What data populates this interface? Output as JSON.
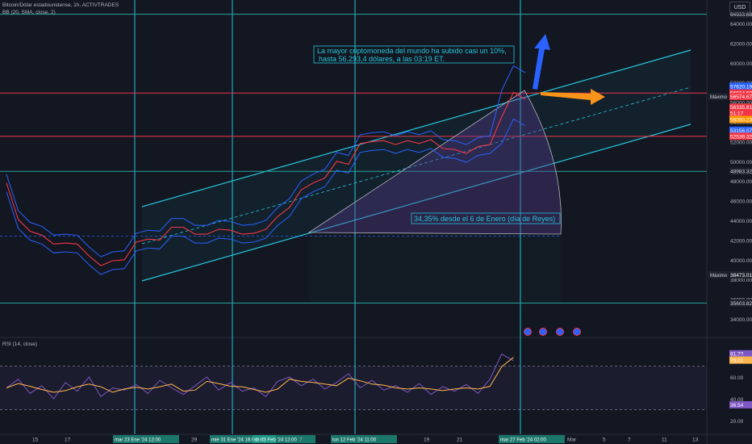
{
  "header": {
    "symbol_line": "Bitcoin/Dólar estadounidense, 1h, ACTIVTRADES",
    "indicator_line": "BB (20, SMA, close, 2)",
    "currency": "USD"
  },
  "rsi_header": "RSI (14, close)",
  "colors": {
    "background": "#131722",
    "cyan": "#26c6da",
    "red": "#f23645",
    "green": "#26a69a",
    "bb": "#2962ff",
    "rsi": "#7e57c2",
    "rsi_ma": "#ffb74d",
    "arrow_blue": "#2962ff",
    "arrow_orange": "#f7931a"
  },
  "chart_data": {
    "type": "line",
    "title": "Bitcoin/Dólar estadounidense, 1h, ACTIVTRADES",
    "xlabel": "",
    "ylabel": "USD",
    "ylim": [
      33500,
      65500
    ],
    "y_ticks": [
      34000,
      36000,
      38000,
      40000,
      42000,
      44000,
      46000,
      48000,
      50000,
      52000,
      54000,
      56000,
      58000,
      60000,
      62000,
      64000
    ],
    "y_tick_labels": [
      "34000.00",
      "36000.00",
      "38000.00",
      "40000.00",
      "42000.00",
      "44000.00",
      "46000.00",
      "48000.00",
      "50000.00",
      "52000.00",
      "54000.00",
      "56000.00",
      "58000.00",
      "60000.00",
      "62000.00",
      "64000.00"
    ],
    "x_tick_labels": [
      "15",
      "17",
      "mar 23 Ene '24  12:00",
      "29",
      "mié 31 Ene '24  16:00",
      "Feb",
      "sb 03 Feb '24  12:00",
      "7",
      "lun 12 Feb '24  11:00",
      "19",
      "21",
      "mar 27 Feb '24  02:00",
      "Mar",
      "5",
      "7",
      "11",
      "13"
    ],
    "series": [
      {
        "name": "Bitcoin/Dólar estadounidense",
        "points": [
          [
            "15 Ene",
            47800
          ],
          [
            "16 Ene",
            44100
          ],
          [
            "17 Ene",
            42900
          ],
          [
            "18 Ene",
            42500
          ],
          [
            "19 Ene",
            41600
          ],
          [
            "20 Ene",
            41700
          ],
          [
            "21 Ene",
            41600
          ],
          [
            "22 Ene",
            40400
          ],
          [
            "23 Ene",
            39400
          ],
          [
            "24 Ene",
            39900
          ],
          [
            "25 Ene",
            40000
          ],
          [
            "26 Ene",
            41800
          ],
          [
            "27 Ene",
            42100
          ],
          [
            "28 Ene",
            42000
          ],
          [
            "29 Ene",
            43300
          ],
          [
            "30 Ene",
            43300
          ],
          [
            "31 Ene",
            42600
          ],
          [
            "01 Feb",
            42600
          ],
          [
            "02 Feb",
            43100
          ],
          [
            "03 Feb",
            43000
          ],
          [
            "04 Feb",
            42600
          ],
          [
            "05 Feb",
            42700
          ],
          [
            "06 Feb",
            43100
          ],
          [
            "07 Feb",
            44400
          ],
          [
            "08 Feb",
            45300
          ],
          [
            "09 Feb",
            47100
          ],
          [
            "10 Feb",
            47800
          ],
          [
            "11 Feb",
            48300
          ],
          [
            "12 Feb",
            50000
          ],
          [
            "13 Feb",
            49700
          ],
          [
            "14 Feb",
            51800
          ],
          [
            "15 Feb",
            52000
          ],
          [
            "16 Feb",
            52100
          ],
          [
            "17 Feb",
            51700
          ],
          [
            "18 Feb",
            52100
          ],
          [
            "19 Feb",
            51800
          ],
          [
            "20 Feb",
            52200
          ],
          [
            "21 Feb",
            51300
          ],
          [
            "22 Feb",
            51200
          ],
          [
            "23 Feb",
            50800
          ],
          [
            "24 Feb",
            51500
          ],
          [
            "25 Feb",
            51700
          ],
          [
            "26 Feb",
            54500
          ],
          [
            "27 Feb",
            57000
          ],
          [
            "28 Feb",
            56293
          ]
        ]
      }
    ],
    "horizontal_levels": [
      {
        "price": 64933.68,
        "label": "64933.68",
        "color": "#26a69a"
      },
      {
        "price": 56934.5,
        "label": "56934.50",
        "color": "#f23645"
      },
      {
        "price": 52539.32,
        "label": "52539.32",
        "color": "#f23645"
      },
      {
        "price": 48983.32,
        "label": "48983.32",
        "color": "#26a69a"
      },
      {
        "price": 35603.82,
        "label": "35603.82",
        "color": "#26a69a"
      }
    ],
    "price_labels": [
      {
        "price": 57620.19,
        "label": "57620.19",
        "color": "#2962ff"
      },
      {
        "price": 56934.5,
        "label": "56934.50",
        "color": "#f23645"
      },
      {
        "price": 56574.67,
        "label": "56574.67",
        "color": "#f23645",
        "prefix": "Máximo"
      },
      {
        "price": 55500,
        "label": "56335.81",
        "color": "#f23645"
      },
      {
        "price": 54900,
        "label": "51:17",
        "color": "#f23645"
      },
      {
        "price": 54250,
        "label": "56080.23",
        "color": "#ff9800"
      },
      {
        "price": 53156.07,
        "label": "53156.07",
        "color": "#2962ff"
      },
      {
        "price": 52539.32,
        "label": "52539.32",
        "color": "#f23645"
      },
      {
        "price": 38473.01,
        "label": "38473.01",
        "color": "#1e222d",
        "prefix": "Máximo"
      }
    ],
    "annotations": [
      "La mayor criptomoneda del mundo ha subido casi un 10%, hasta 56.293,4 dólares, a las 03:19 ET.",
      "34,35% desde el 6 de Enero (día de Reyes)"
    ],
    "grid": false,
    "legend": "none"
  },
  "rsi_data": {
    "y_ticks": [
      20,
      40,
      60
    ],
    "y_tick_labels": [
      "20.00",
      "40.00",
      "60.00"
    ],
    "levels": [
      70,
      30
    ],
    "labels": [
      {
        "value": 81.3,
        "text": "81.??",
        "color": "#7e57c2"
      },
      {
        "value": 75.5,
        "text": "76.01",
        "color": "#ffb74d"
      },
      {
        "value": 34.5,
        "text": "36.54",
        "color": "#7e57c2"
      }
    ]
  }
}
